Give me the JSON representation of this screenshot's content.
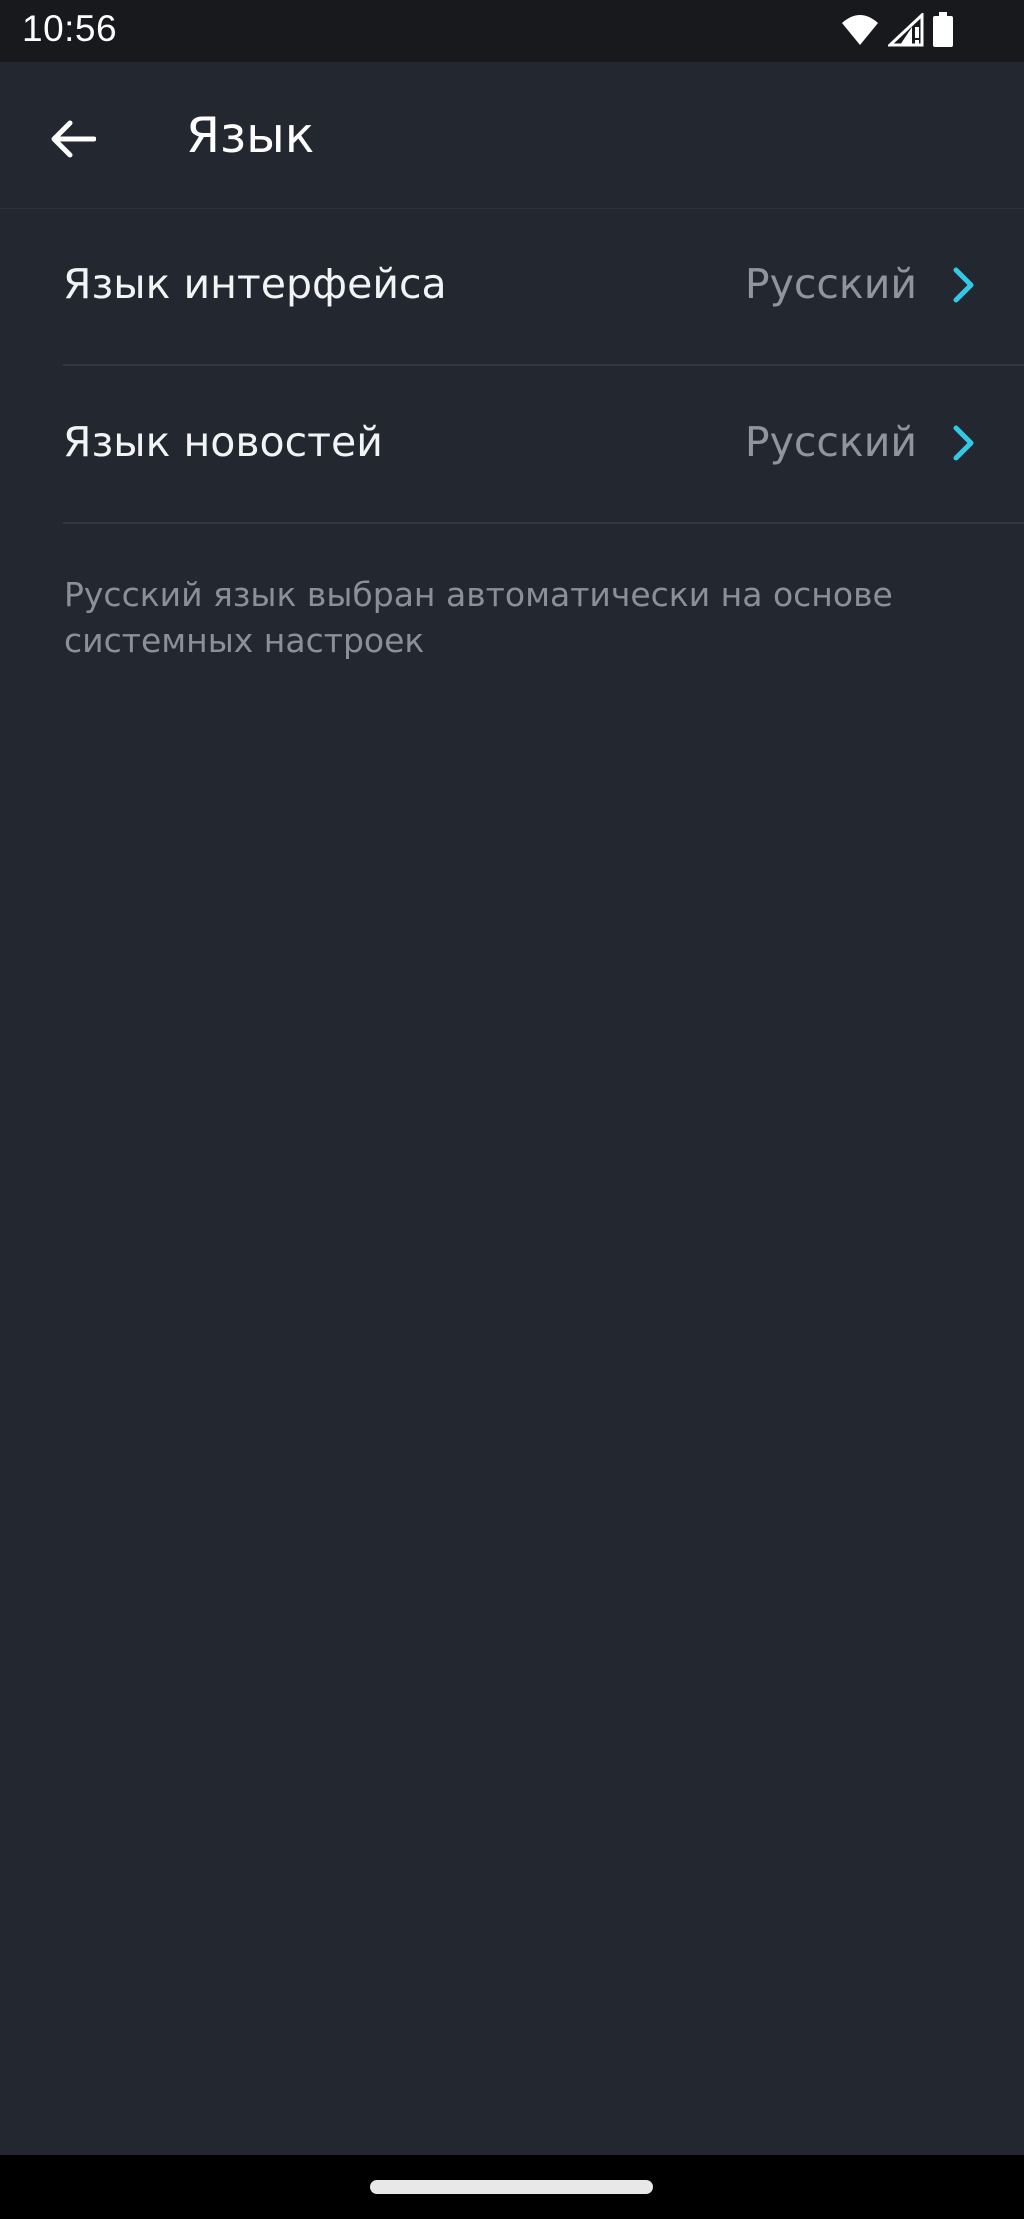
{
  "status_bar": {
    "time": "10:56",
    "icons": [
      "wifi-icon",
      "signal-icon",
      "battery-icon"
    ]
  },
  "header": {
    "title": "Язык",
    "back_icon": "arrow-left-icon"
  },
  "settings": {
    "items": [
      {
        "label": "Язык интерфейса",
        "value": "Русский"
      },
      {
        "label": "Язык новостей",
        "value": "Русский"
      }
    ],
    "note": "Русский язык выбран автоматически на основе системных настроек"
  },
  "colors": {
    "background": "#23272f",
    "accent": "#33c8e6",
    "primary_text": "#f2f3f5",
    "secondary_text": "#8f949d"
  }
}
